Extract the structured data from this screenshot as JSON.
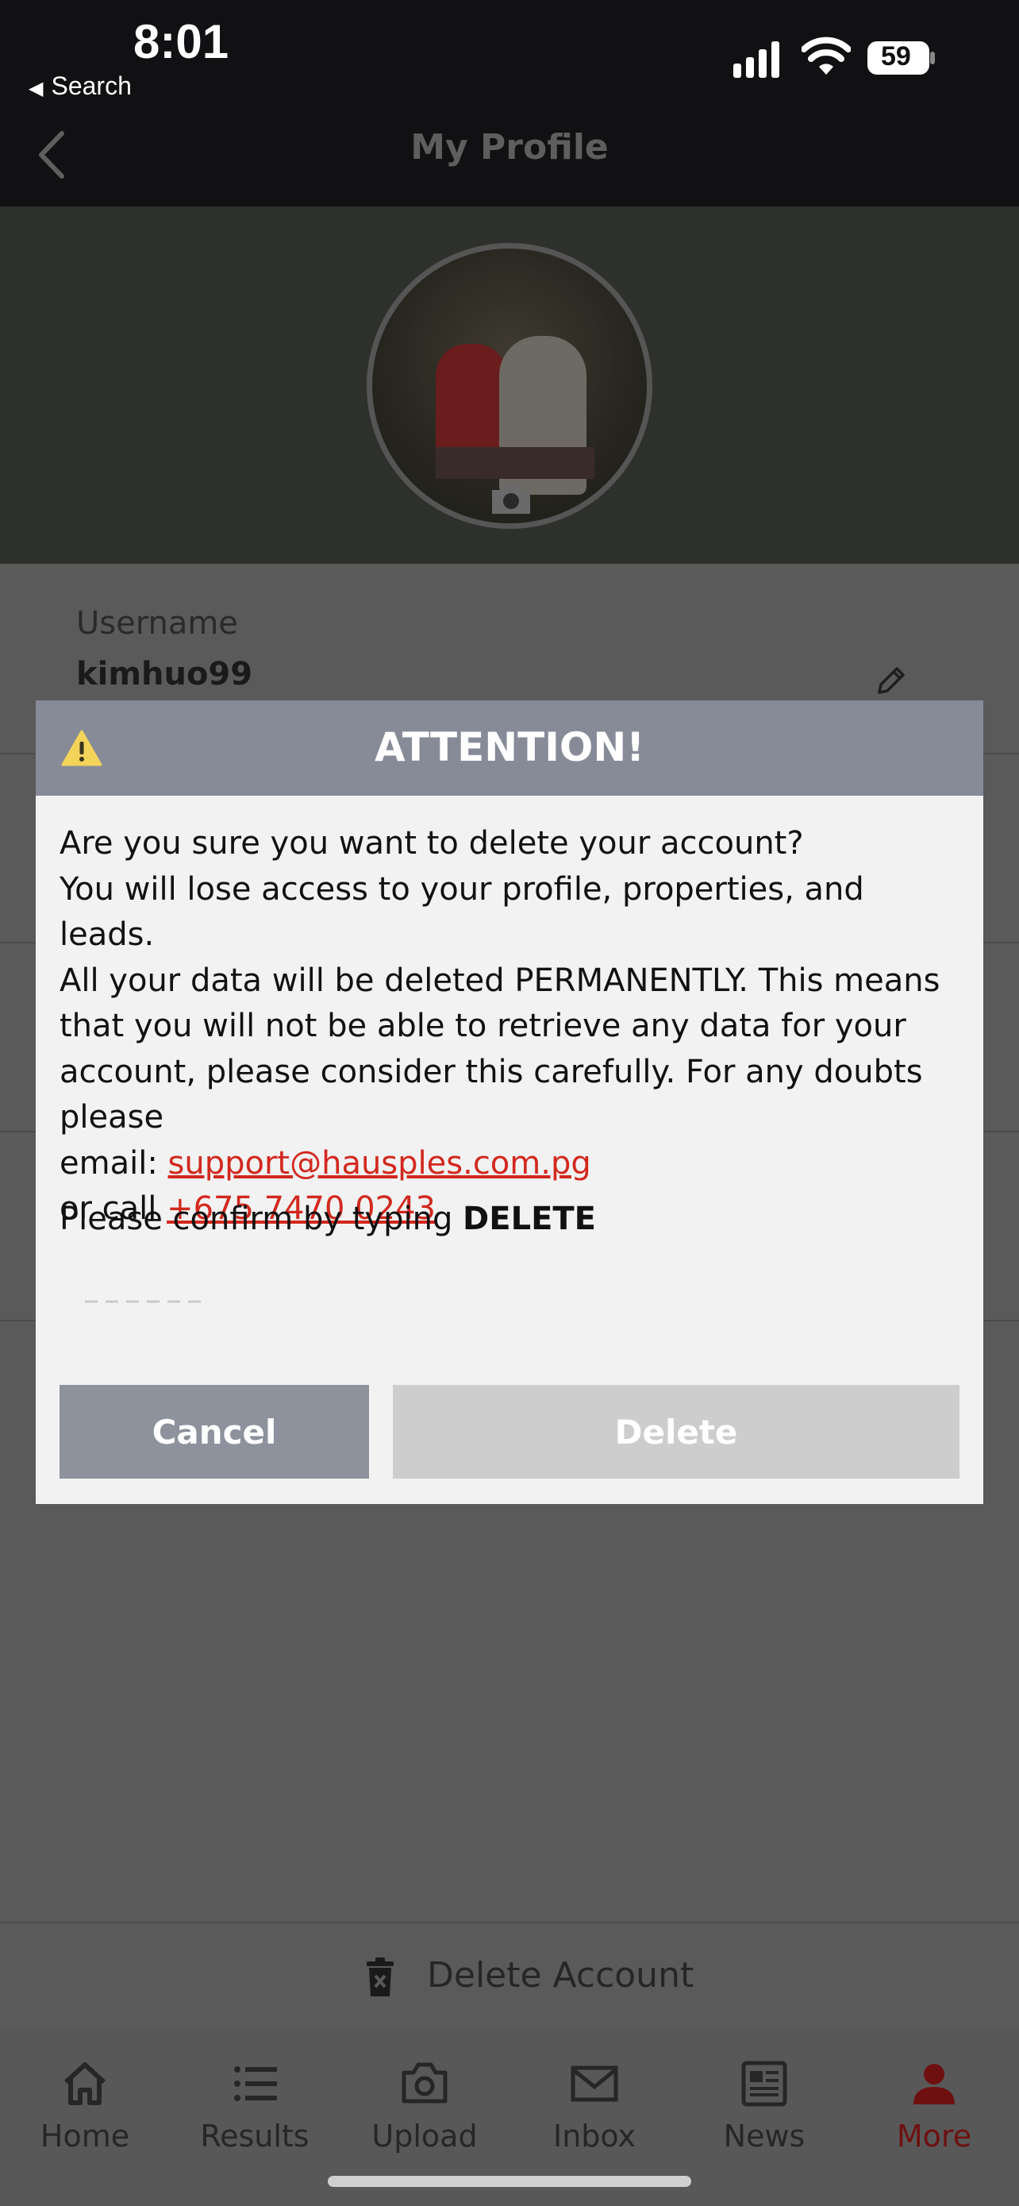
{
  "status_bar": {
    "time": "8:01",
    "back_label": "Search",
    "battery_level": "59"
  },
  "nav": {
    "title": "My Profile"
  },
  "profile": {
    "rows": [
      {
        "label": "Username",
        "value": "kimhuo99"
      }
    ]
  },
  "delete_account": {
    "label": "Delete Account"
  },
  "tabbar": {
    "items": [
      {
        "label": "Home",
        "icon": "home-icon"
      },
      {
        "label": "Results",
        "icon": "list-icon"
      },
      {
        "label": "Upload",
        "icon": "camera-icon"
      },
      {
        "label": "Inbox",
        "icon": "mail-icon"
      },
      {
        "label": "News",
        "icon": "newspaper-icon"
      },
      {
        "label": "More",
        "icon": "person-icon",
        "active": true
      }
    ],
    "active_color": "#6e1010"
  },
  "modal": {
    "title": "ATTENTION!",
    "line1": "Are you sure you want to delete your account?",
    "line2": "You will lose access to your profile, properties, and leads.",
    "line3": "All your data will be deleted PERMANENTLY. This means that you will not be able to retrieve any data for your account, please consider this carefully. For any doubts please",
    "email_prefix": "email: ",
    "email": "support@hausples.com.pg",
    "call_prefix": "or call ",
    "phone": "+675 7470 0243",
    "confirm_prefix": "Please confirm by typing ",
    "confirm_word": "DELETE",
    "input_placeholder": "––––––",
    "cancel_label": "Cancel",
    "delete_label": "Delete",
    "link_color": "#d2281e",
    "header_color": "#878b98"
  }
}
